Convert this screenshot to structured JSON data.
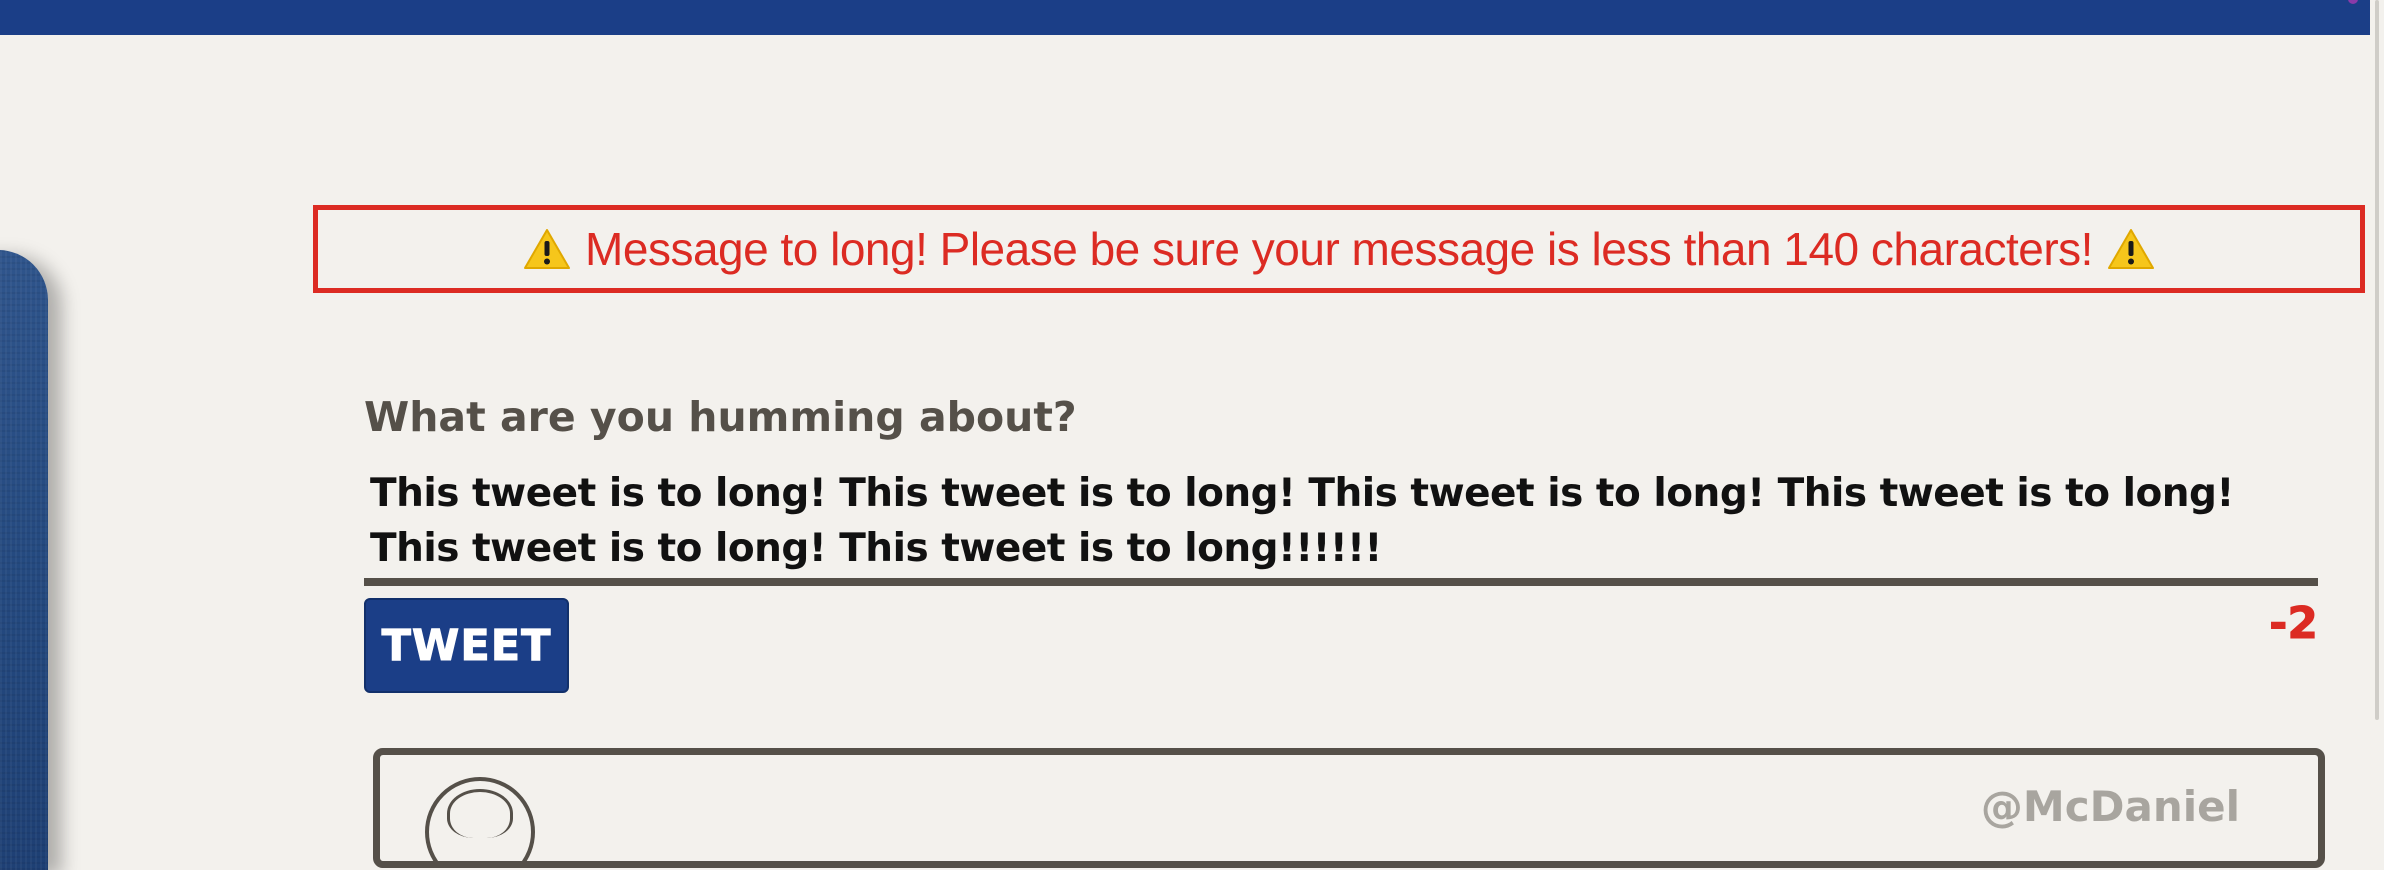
{
  "header": {
    "bar_color": "#1b3e87"
  },
  "alert": {
    "message": "Message to long! Please be sure your message is less than 140 characters!",
    "icon_left": "warning-icon",
    "icon_right": "warning-icon",
    "color": "#dc2b23"
  },
  "composer": {
    "prompt": "What are you humming about?",
    "input_value": "This tweet is to long! This tweet is to long! This tweet is to long! This tweet is to long! This tweet is to long! This tweet is to long!!!!!!",
    "submit_label": "TWEET",
    "remaining_chars": "-2"
  },
  "feed": {
    "items": [
      {
        "handle": "@McDaniel",
        "avatar_icon": "avatar-icon"
      }
    ]
  },
  "colors": {
    "brand": "#1b3e87",
    "error": "#dc2b23",
    "background": "#f3f1ed",
    "text_muted": "#555049"
  }
}
